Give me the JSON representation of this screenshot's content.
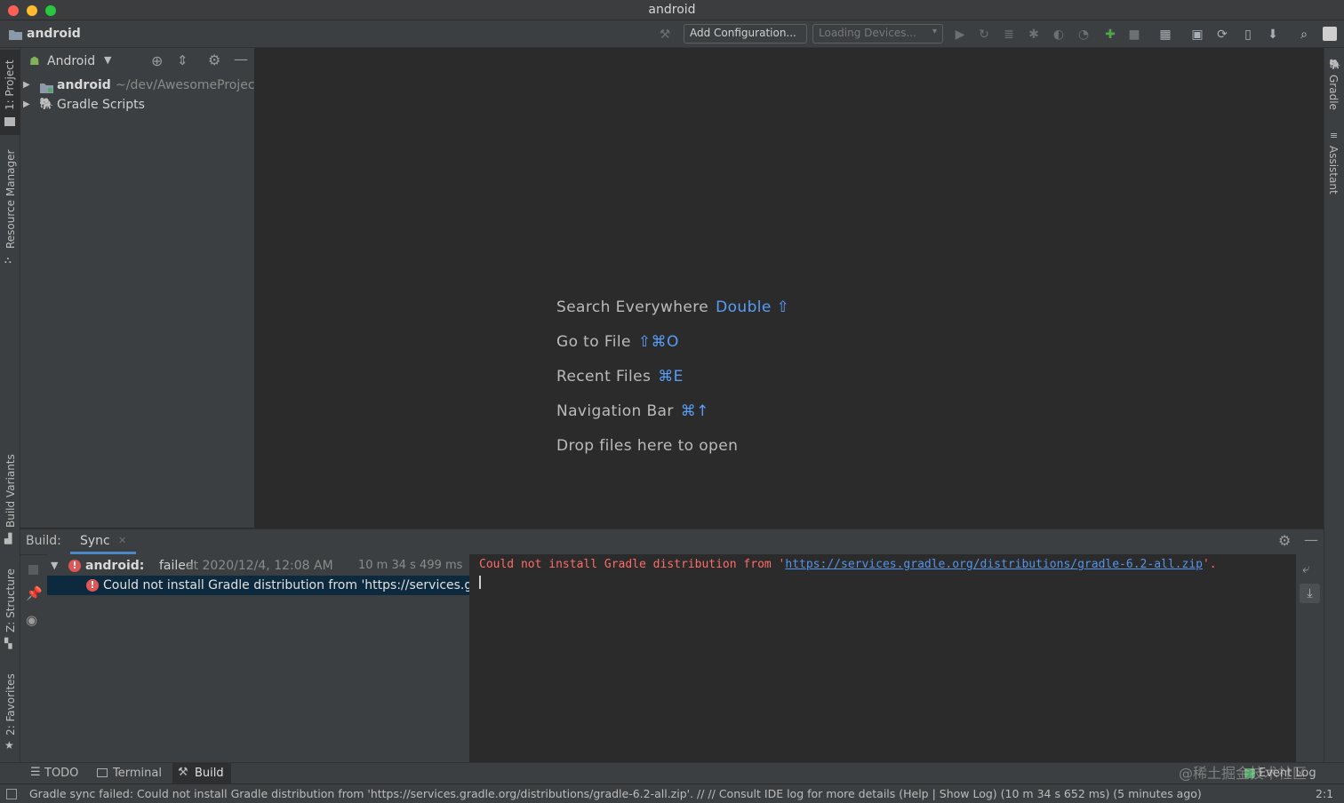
{
  "window": {
    "title": "android"
  },
  "navbar": {
    "project_name": "android",
    "add_configuration": "Add Configuration...",
    "devices_dropdown": "Loading Devices..."
  },
  "left_stripe": {
    "project_tab": "1: Project",
    "resource_manager_tab": "Resource Manager",
    "build_variants_tab": "Build Variants",
    "structure_tab": "Z: Structure",
    "favorites_tab": "2: Favorites"
  },
  "right_stripe": {
    "gradle_tab": "Gradle",
    "assistant_tab": "Assistant"
  },
  "project_panel": {
    "view_selector": "Android",
    "tree": [
      {
        "name": "android",
        "path": "~/dev/AwesomeProject"
      },
      {
        "name": "Gradle Scripts"
      }
    ]
  },
  "editor_hints": [
    {
      "label": "Search Everywhere",
      "shortcut": "Double ⇧"
    },
    {
      "label": "Go to File",
      "shortcut": "⇧⌘O"
    },
    {
      "label": "Recent Files",
      "shortcut": "⌘E"
    },
    {
      "label": "Navigation Bar",
      "shortcut": "⌘↑"
    },
    {
      "label": "Drop files here to open",
      "shortcut": ""
    }
  ],
  "build": {
    "label": "Build:",
    "tab": "Sync",
    "tree": {
      "root_name": "android:",
      "root_status": "failed",
      "root_time": "at 2020/12/4, 12:08 AM",
      "root_duration": "10 m 34 s 499 ms",
      "child_text": "Could not install Gradle distribution from 'https://services.gradle.org/distributions/gradle-6.2-all.zip'."
    },
    "console": {
      "prefix": "Could not install Gradle distribution from '",
      "link": "https://services.gradle.org/distributions/gradle-6.2-all.zip",
      "suffix": "'."
    }
  },
  "bottom_tabs": {
    "todo": "TODO",
    "terminal": "Terminal",
    "build": "Build",
    "event_log": "Event Log",
    "watermark": "@稀土掘金技术社区"
  },
  "status_bar": {
    "message": "Gradle sync failed: Could not install Gradle distribution from 'https://services.gradle.org/distributions/gradle-6.2-all.zip'. // // Consult IDE log for more details (Help | Show Log) (10 m 34 s 652 ms) (5 minutes ago)",
    "position": "2:1"
  },
  "colors": {
    "accent": "#589df6",
    "error": "#ff6b68",
    "link": "#5394ec",
    "selection": "#0d293e"
  }
}
